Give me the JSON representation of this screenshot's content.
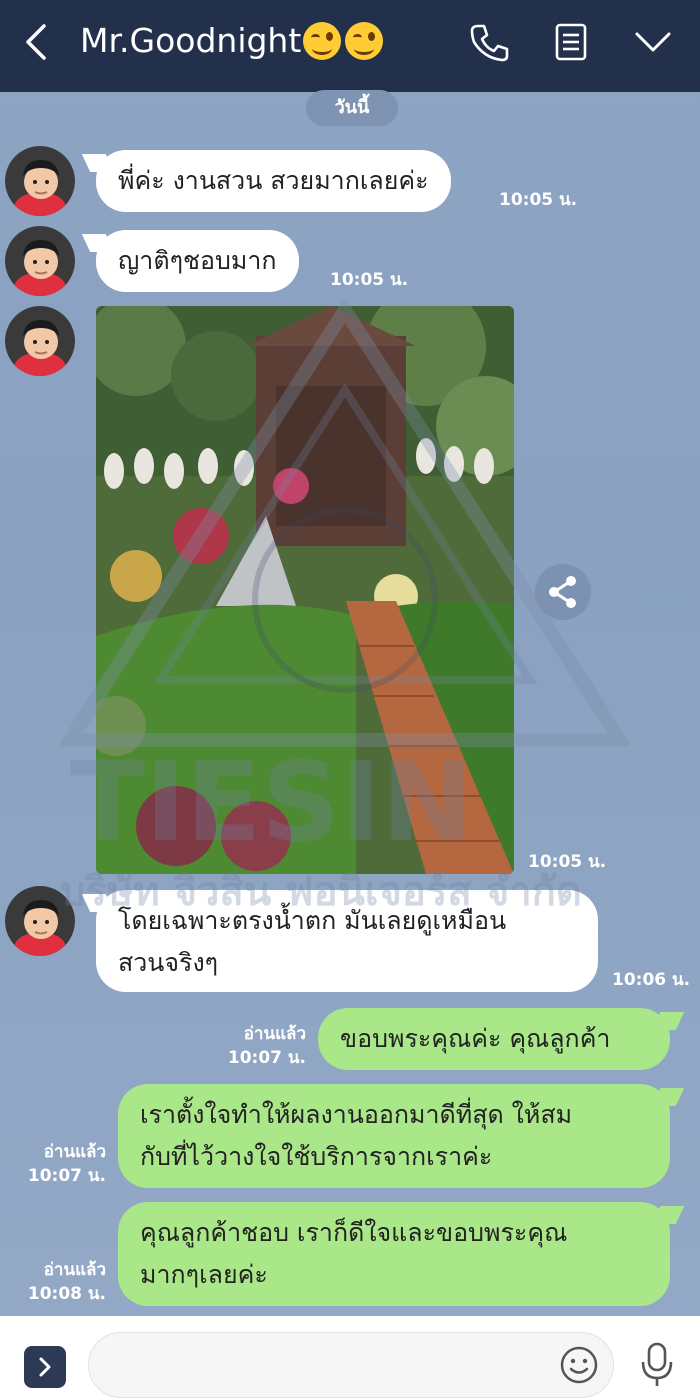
{
  "header": {
    "title": "Mr.Goodnight",
    "bg_color": "#23304c"
  },
  "date_separator": "วันนี้",
  "messages": [
    {
      "text": "พี่ค่ะ งานสวน สวยมากเลยค่ะ",
      "time": "10:05 น.",
      "side": "incoming"
    },
    {
      "text": "ญาติๆชอบมาก",
      "time": "10:05 น.",
      "side": "incoming"
    },
    {
      "type": "photo",
      "time": "10:05 น.",
      "side": "incoming"
    },
    {
      "text_line1": "โดยเฉพาะตรงน้ำตก มันเลยดูเหมือน",
      "text_line2": "สวนจริงๆ",
      "time": "10:06 น.",
      "side": "incoming"
    },
    {
      "text": "ขอบพระคุณค่ะ คุณลูกค้า",
      "read": "อ่านแล้ว",
      "time": "10:07 น.",
      "side": "outgoing"
    },
    {
      "text_line1": "เราตั้งใจทำให้ผลงานออกมาดีที่สุด ให้สม",
      "text_line2": "กับที่ไว้วางใจใช้บริการจากเราค่ะ",
      "read": "อ่านแล้ว",
      "time": "10:07 น.",
      "side": "outgoing"
    },
    {
      "text_line1": "คุณลูกค้าชอบ เราก็ดีใจและขอบพระคุณ",
      "text_line2": "มากๆเลยค่ะ",
      "read": "อ่านแล้ว",
      "time": "10:08 น.",
      "side": "outgoing"
    }
  ],
  "watermark": {
    "brand": "TIESIN",
    "company": "บริษัท จิวสิน ฟอนิเจอร์ส จำกัด"
  },
  "colors": {
    "chat_bg": "#8ea4c3",
    "incoming_bubble": "#ffffff",
    "outgoing_bubble": "#a9e788"
  },
  "icons": {
    "back": "chevron-left-icon",
    "call": "phone-icon",
    "notes": "note-icon",
    "menu": "chevron-down-icon",
    "share": "share-icon",
    "expand": "chevron-right-icon",
    "emoji": "smiley-icon",
    "mic": "microphone-icon"
  }
}
